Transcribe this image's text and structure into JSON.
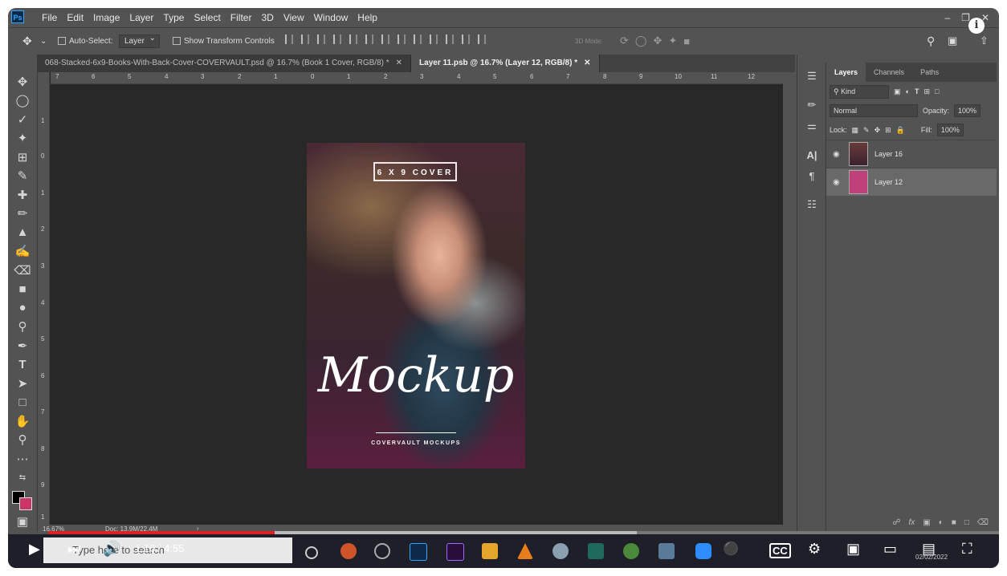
{
  "menubar": {
    "logo": "Ps",
    "items": [
      "File",
      "Edit",
      "Image",
      "Layer",
      "Type",
      "Select",
      "Filter",
      "3D",
      "View",
      "Window",
      "Help"
    ]
  },
  "options": {
    "auto_select_label": "Auto-Select:",
    "auto_select_value": "Layer",
    "transform_label": "Show Transform Controls",
    "mode3d_label": "3D Mode:"
  },
  "tabs": [
    {
      "label": "068-Stacked-6x9-Books-With-Back-Cover-COVERVAULT.psd @ 16.7% (Book 1 Cover, RGB/8) *"
    },
    {
      "label": "Layer 11.psb @ 16.7% (Layer 12, RGB/8) *"
    }
  ],
  "ruler_top": [
    "7",
    "6",
    "5",
    "4",
    "3",
    "2",
    "1",
    "0",
    "1",
    "2",
    "3",
    "4",
    "5",
    "6",
    "7",
    "8",
    "9",
    "10",
    "11",
    "12"
  ],
  "ruler_left": [
    "1",
    "0",
    "1",
    "2",
    "3",
    "4",
    "5",
    "6",
    "7",
    "8",
    "9",
    "1"
  ],
  "document": {
    "cover_label": "6 X 9 COVER",
    "title": "Mockup",
    "subtitle": "COVERVAULT MOCKUPS"
  },
  "status": {
    "zoom": "16.67%",
    "doc": "Doc: 13.9M/22.4M"
  },
  "layers_panel": {
    "tabs": [
      "Layers",
      "Channels",
      "Paths"
    ],
    "kind_label": "Kind",
    "blend_mode": "Normal",
    "opacity_label": "Opacity:",
    "opacity_value": "100%",
    "lock_label": "Lock:",
    "fill_label": "Fill:",
    "fill_value": "100%",
    "layers": [
      {
        "name": "Layer 16",
        "selected": false
      },
      {
        "name": "Layer 12",
        "selected": true
      }
    ]
  },
  "taskbar": {
    "search_placeholder": "Type here to search",
    "date": "02/02/2022"
  },
  "player": {
    "time": "1:16 / 4:55",
    "played_fraction": 0.258
  },
  "colors": {
    "accent_red": "#e02020",
    "fg_swatch": "#000000",
    "bg_swatch": "#cc3366"
  }
}
